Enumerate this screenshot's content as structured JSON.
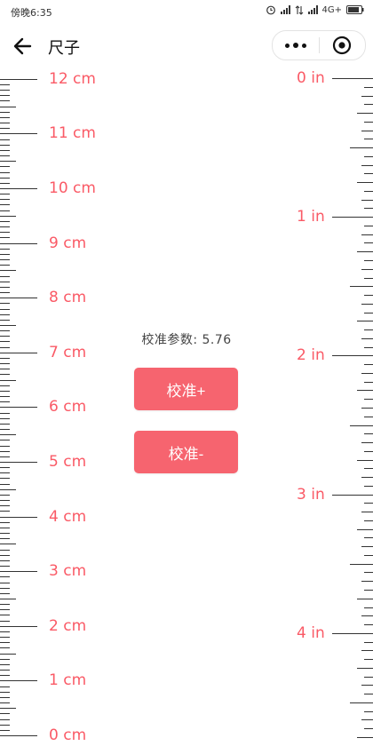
{
  "status_bar": {
    "time": "傍晚6:35",
    "network": "4G+"
  },
  "nav": {
    "title": "尺子"
  },
  "calibration": {
    "label": "校准参数: 5.76",
    "plus_label": "校准+",
    "minus_label": "校准-"
  },
  "ruler": {
    "cm_labels": [
      "0 cm",
      "1 cm",
      "2 cm",
      "3 cm",
      "4 cm",
      "5 cm",
      "6 cm",
      "7 cm",
      "8 cm",
      "9 cm",
      "10 cm",
      "11 cm",
      "12 cm"
    ],
    "inch_labels": [
      "0 in",
      "1 in",
      "2 in",
      "3 in",
      "4 in"
    ]
  },
  "colors": {
    "accent": "#f6646f",
    "label": "#fa5a66",
    "tick": "#333333"
  }
}
